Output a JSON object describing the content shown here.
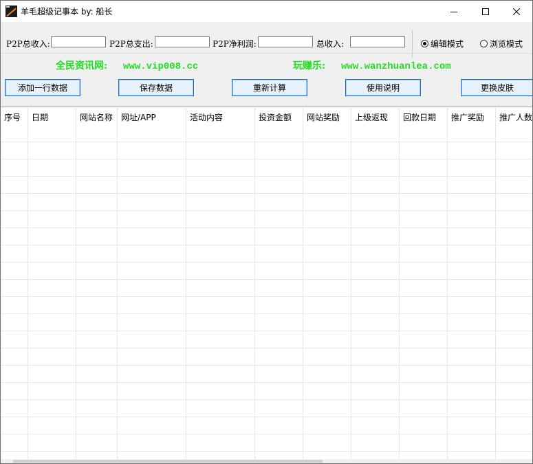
{
  "window": {
    "title": "羊毛超级记事本  by: 船长",
    "icon": "notebook-app-icon"
  },
  "toolbar": {
    "fields": [
      {
        "label": "P2P总收入:",
        "value": ""
      },
      {
        "label": "P2P总支出:",
        "value": ""
      },
      {
        "label": "P2P净利润:",
        "value": ""
      },
      {
        "label": "总收入:",
        "value": ""
      }
    ],
    "modes": [
      {
        "label": "编辑模式",
        "selected": true
      },
      {
        "label": "浏览模式",
        "selected": false
      }
    ]
  },
  "promo": {
    "site1_name": "全民资讯网:",
    "site1_url": "www.vip008.cc",
    "site2_name": "玩赚乐:",
    "site2_url": "www.wanzhuanlea.com",
    "color": "#22dd22"
  },
  "buttons": [
    "添加一行数据",
    "保存数据",
    "重新计算",
    "使用说明",
    "更换皮肤"
  ],
  "table": {
    "columns": [
      "序号",
      "日期",
      "网站名称",
      "网址/APP",
      "活动内容",
      "投资金额",
      "网站奖励",
      "上级返现",
      "回款日期",
      "推广奖励",
      "推广人数"
    ],
    "rows": []
  },
  "colors": {
    "button_border": "#1a6fd0",
    "button_bg": "#e5f1fb"
  }
}
